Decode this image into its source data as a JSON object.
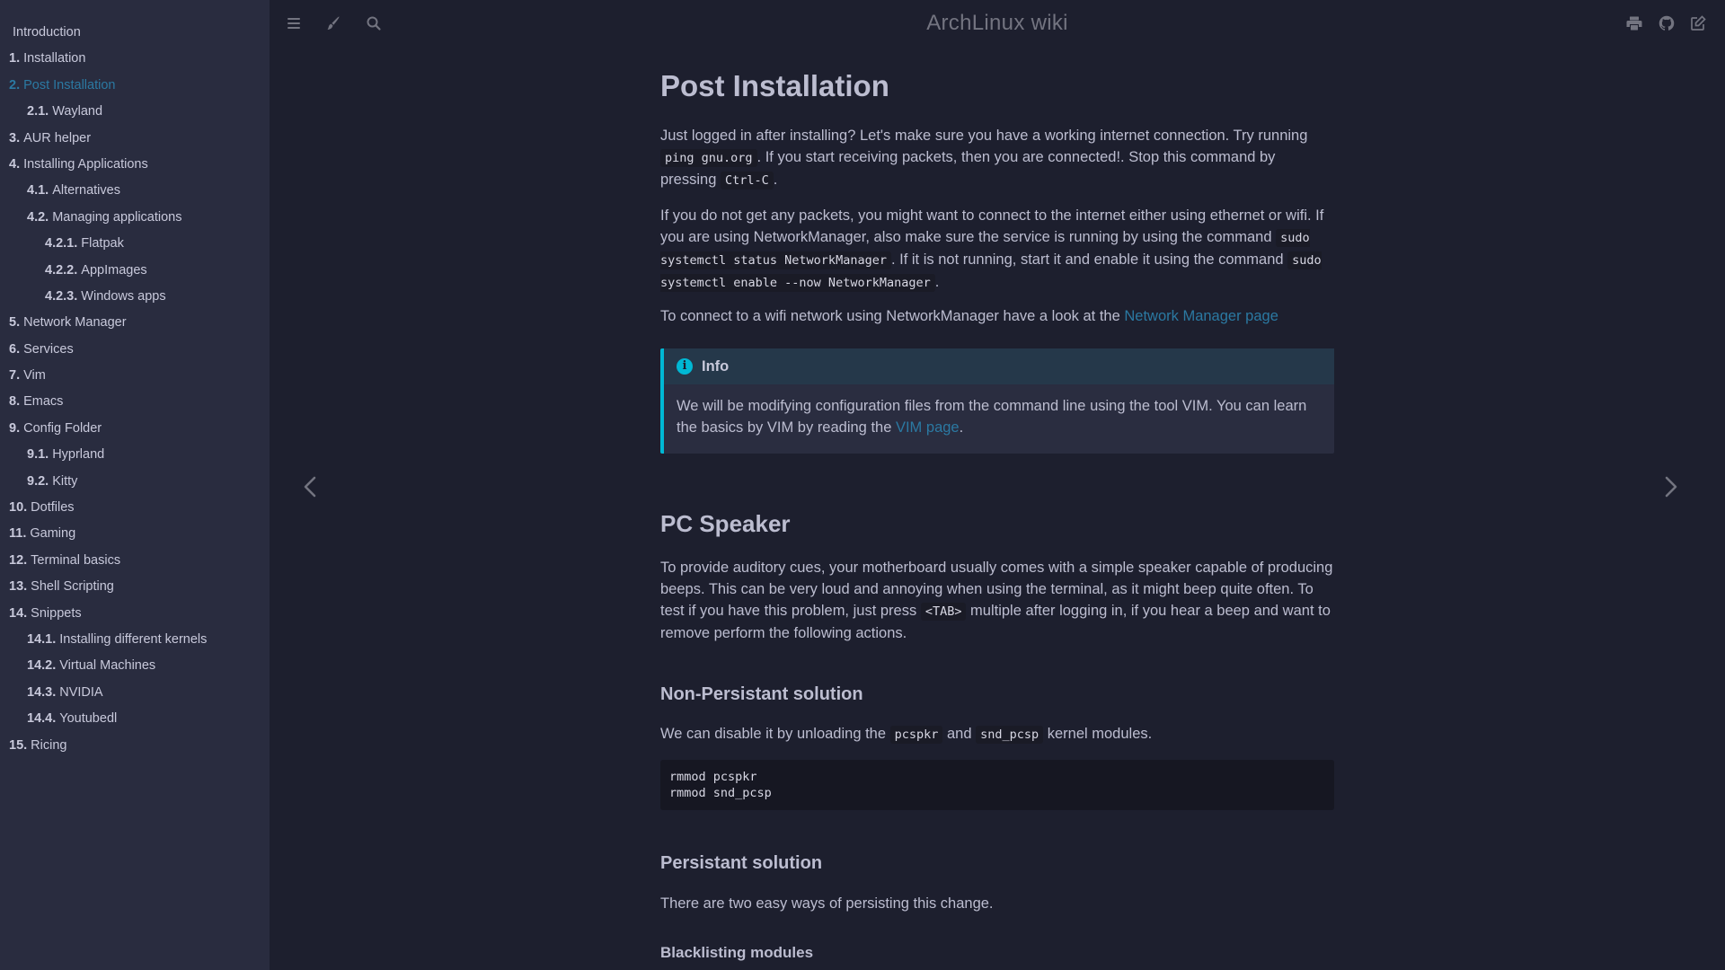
{
  "sidebar": {
    "items": [
      {
        "num": "",
        "label": "Introduction",
        "level": 0,
        "active": false
      },
      {
        "num": "1.",
        "label": "Installation",
        "level": 0,
        "active": false
      },
      {
        "num": "2.",
        "label": "Post Installation",
        "level": 0,
        "active": true
      },
      {
        "num": "2.1.",
        "label": "Wayland",
        "level": 1,
        "active": false
      },
      {
        "num": "3.",
        "label": "AUR helper",
        "level": 0,
        "active": false
      },
      {
        "num": "4.",
        "label": "Installing Applications",
        "level": 0,
        "active": false
      },
      {
        "num": "4.1.",
        "label": "Alternatives",
        "level": 1,
        "active": false
      },
      {
        "num": "4.2.",
        "label": "Managing applications",
        "level": 1,
        "active": false
      },
      {
        "num": "4.2.1.",
        "label": "Flatpak",
        "level": 2,
        "active": false
      },
      {
        "num": "4.2.2.",
        "label": "AppImages",
        "level": 2,
        "active": false
      },
      {
        "num": "4.2.3.",
        "label": "Windows apps",
        "level": 2,
        "active": false
      },
      {
        "num": "5.",
        "label": "Network Manager",
        "level": 0,
        "active": false
      },
      {
        "num": "6.",
        "label": "Services",
        "level": 0,
        "active": false
      },
      {
        "num": "7.",
        "label": "Vim",
        "level": 0,
        "active": false
      },
      {
        "num": "8.",
        "label": "Emacs",
        "level": 0,
        "active": false
      },
      {
        "num": "9.",
        "label": "Config Folder",
        "level": 0,
        "active": false
      },
      {
        "num": "9.1.",
        "label": "Hyprland",
        "level": 1,
        "active": false
      },
      {
        "num": "9.2.",
        "label": "Kitty",
        "level": 1,
        "active": false
      },
      {
        "num": "10.",
        "label": "Dotfiles",
        "level": 0,
        "active": false
      },
      {
        "num": "11.",
        "label": "Gaming",
        "level": 0,
        "active": false
      },
      {
        "num": "12.",
        "label": "Terminal basics",
        "level": 0,
        "active": false
      },
      {
        "num": "13.",
        "label": "Shell Scripting",
        "level": 0,
        "active": false
      },
      {
        "num": "14.",
        "label": "Snippets",
        "level": 0,
        "active": false
      },
      {
        "num": "14.1.",
        "label": "Installing different kernels",
        "level": 1,
        "active": false
      },
      {
        "num": "14.2.",
        "label": "Virtual Machines",
        "level": 1,
        "active": false
      },
      {
        "num": "14.3.",
        "label": "NVIDIA",
        "level": 1,
        "active": false
      },
      {
        "num": "14.4.",
        "label": "Youtubedl",
        "level": 1,
        "active": false
      },
      {
        "num": "15.",
        "label": "Ricing",
        "level": 0,
        "active": false
      }
    ]
  },
  "topbar": {
    "title": "ArchLinux wiki",
    "left_icons": [
      "menu-icon",
      "paintbrush-icon",
      "search-icon"
    ],
    "right_icons": [
      "print-icon",
      "github-icon",
      "edit-icon"
    ]
  },
  "colors": {
    "background": "#1d1f2e",
    "sidebar": "#292c3f",
    "text": "#bcbdd0",
    "link": "#2b79a2",
    "info_accent": "#00b8d4"
  },
  "content": {
    "h1": "Post Installation",
    "p1": {
      "a": "Just logged in after installing? Let's make sure you have a working internet connection. Try running ",
      "code1": "ping gnu.org",
      "b": ". If you start receiving packets, then you are connected!. Stop this command by pressing ",
      "code2": "Ctrl-C",
      "c": "."
    },
    "p2": {
      "a": "If you do not get any packets, you might want to connect to the internet either using ethernet or wifi. If you are using NetworkManager, also make sure the service is running by using the command ",
      "code1": "sudo systemctl status NetworkManager",
      "b": ". If it is not running, start it and enable it using the command ",
      "code2": "sudo systemctl enable --now NetworkManager",
      "c": "."
    },
    "p3": {
      "a": "To connect to a wifi network using NetworkManager have a look at the ",
      "link": "Network Manager page"
    },
    "info": {
      "title": "Info",
      "icon": "i",
      "text": "We will be modifying configuration files from the command line using the tool VIM. You can learn the basics by VIM by reading the ",
      "link": "VIM page",
      "end": "."
    },
    "h2_speaker": "PC Speaker",
    "p4": {
      "a": "To provide auditory cues, your motherboard usually comes with a simple speaker capable of producing beeps. This can be very loud and annoying when using the terminal, as it might beep quite often. To test if you have this problem, just press ",
      "code": "<TAB>",
      "b": " multiple after logging in, if you hear a beep and want to remove perform the following actions."
    },
    "h3_nonpersist": "Non-Persistant solution",
    "p5": {
      "a": "We can disable it by unloading the ",
      "code1": "pcspkr",
      "b": " and ",
      "code2": "snd_pcsp",
      "c": " kernel modules."
    },
    "codeblock": "rmmod pcspkr\nrmmod snd_pcsp",
    "h3_persist": "Persistant solution",
    "p6": "There are two easy ways of persisting this change.",
    "h4_blacklist": "Blacklisting modules"
  }
}
